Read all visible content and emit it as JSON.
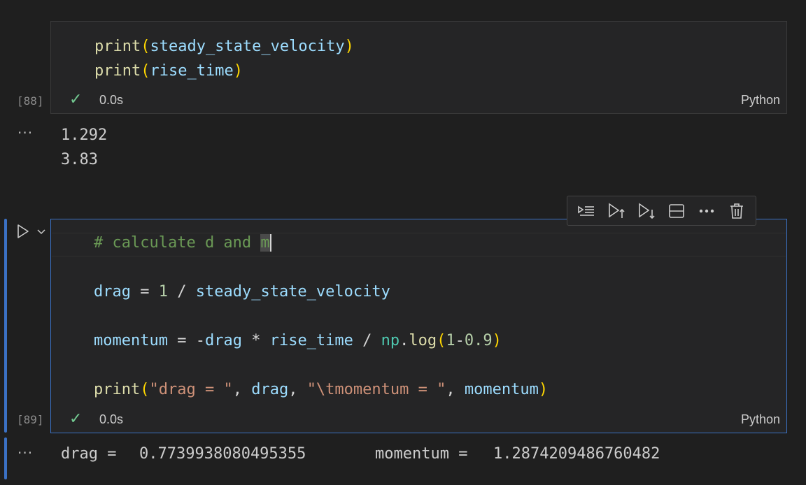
{
  "cells": [
    {
      "exec_count": "[88]",
      "status_time": "0.0s",
      "language": "Python",
      "code_lines": [
        {
          "fn": "print",
          "open": "(",
          "arg": "steady_state_velocity",
          "close": ")"
        },
        {
          "fn": "print",
          "open": "(",
          "arg": "rise_time",
          "close": ")"
        }
      ],
      "output_lines": [
        "1.292",
        "3.83"
      ]
    },
    {
      "exec_count": "[89]",
      "status_time": "0.0s",
      "language": "Python",
      "comment_text": "# calculate d and ",
      "comment_cursor_char": "m",
      "line2": {
        "lhs": "drag",
        "eq": " = ",
        "num": "1",
        "div": " / ",
        "rhs": "steady_state_velocity"
      },
      "line3": {
        "lhs": "momentum",
        "eq": " = ",
        "neg": "-",
        "drag": "drag",
        "mul": " * ",
        "rise": "rise_time",
        "div": " / ",
        "mod": "np",
        "dot": ".",
        "fn": "log",
        "open": "(",
        "n1": "1",
        "minus": "-",
        "n2": "0.9",
        "close": ")"
      },
      "line4": {
        "fn": "print",
        "open": "(",
        "s1": "\"drag = \"",
        "c1": ", ",
        "v1": "drag",
        "c2": ", ",
        "s2": "\"\\tmomentum = \"",
        "c3": ", ",
        "v2": "momentum",
        "close": ")"
      },
      "output_label1": "drag = ",
      "output_value1": "0.7739938080495355",
      "output_label2": "momentum = ",
      "output_value2": "1.2874209486760482"
    }
  ],
  "output_more_icon": "ellipsis-icon",
  "toolbar_icons": [
    "run-above-icon",
    "execute-above-icon",
    "execute-below-icon",
    "split-cell-icon",
    "more-actions-icon",
    "delete-cell-icon"
  ],
  "colors": {
    "background": "#1f1f1f",
    "cell_background": "#252526",
    "focus_border": "#3b71c4",
    "check": "#73c991"
  }
}
